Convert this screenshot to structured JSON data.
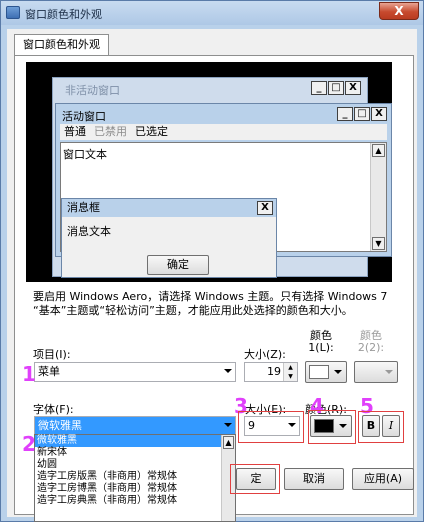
{
  "window": {
    "title": "窗口颜色和外观",
    "close_glyph": "X"
  },
  "tab": {
    "label": "窗口颜色和外观"
  },
  "preview": {
    "inactive_title": "非活动窗口",
    "active_title": "活动窗口",
    "caption_glyphs": [
      "_",
      "□",
      "X"
    ],
    "menu": {
      "normal": "普通",
      "disabled": "已禁用",
      "selected": "已选定"
    },
    "window_text": "窗口文本",
    "message_box": {
      "title": "消息框",
      "text": "消息文本",
      "ok": "确定",
      "close_glyph": "X"
    }
  },
  "note": "要启用 Windows Aero，请选择 Windows 主题。只有选择 Windows 7 “基本”主题或“轻松访问”主题，才能应用此处选择的颜色和大小。",
  "labels": {
    "item": "项目(I):",
    "size": "大小(Z):",
    "color1": "颜色\n1(L):",
    "color2": "颜色\n2(2):",
    "font": "字体(F):",
    "font_size": "大小(E):",
    "font_color": "颜色(R):"
  },
  "values": {
    "item": "菜单",
    "size": "19",
    "font": "微软雅黑",
    "font_size": "9"
  },
  "format": {
    "bold": "B",
    "italic": "I"
  },
  "font_list": [
    "微软雅黑",
    "新宋体",
    "幼圆",
    "造字工房版黑（非商用）常规体",
    "造字工房博黑（非商用）常规体",
    "造字工房典黑（非商用）常规体"
  ],
  "buttons": {
    "ok": "确定",
    "ok_visible": "定",
    "cancel": "取消",
    "apply": "应用(A)"
  },
  "marks": [
    "1",
    "2",
    "3",
    "4",
    "5"
  ],
  "colors": {
    "accent_mark": "#e040fb",
    "highlight": "#e04040",
    "selection": "#3399ff",
    "font_color_swatch": "#000000",
    "color1_swatch": "#ffffff"
  }
}
